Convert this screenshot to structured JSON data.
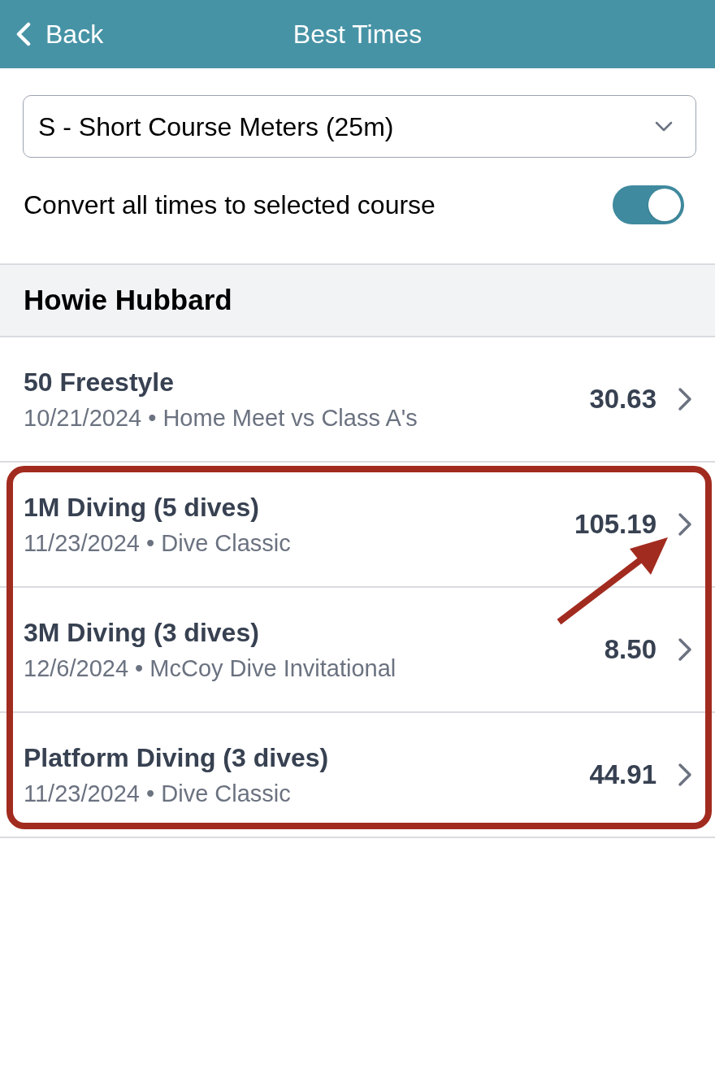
{
  "header": {
    "back_label": "Back",
    "title": "Best Times"
  },
  "course_select": {
    "value": "S - Short Course Meters (25m)"
  },
  "convert_toggle": {
    "label": "Convert all times to selected course",
    "on": true
  },
  "section": {
    "title": "Howie Hubbard"
  },
  "rows": [
    {
      "event": "50 Freestyle",
      "subtitle": "10/21/2024 • Home Meet vs Class A's",
      "time": "30.63",
      "highlighted": false,
      "arrow": false
    },
    {
      "event": "1M Diving (5 dives)",
      "subtitle": "11/23/2024 • Dive Classic",
      "time": "105.19",
      "highlighted": true,
      "arrow": true
    },
    {
      "event": "3M Diving (3 dives)",
      "subtitle": "12/6/2024 • McCoy Dive Invitational",
      "time": "8.50",
      "highlighted": true,
      "arrow": false
    },
    {
      "event": "Platform Diving (3 dives)",
      "subtitle": "11/23/2024 • Dive Classic",
      "time": "44.91",
      "highlighted": true,
      "arrow": false
    }
  ]
}
